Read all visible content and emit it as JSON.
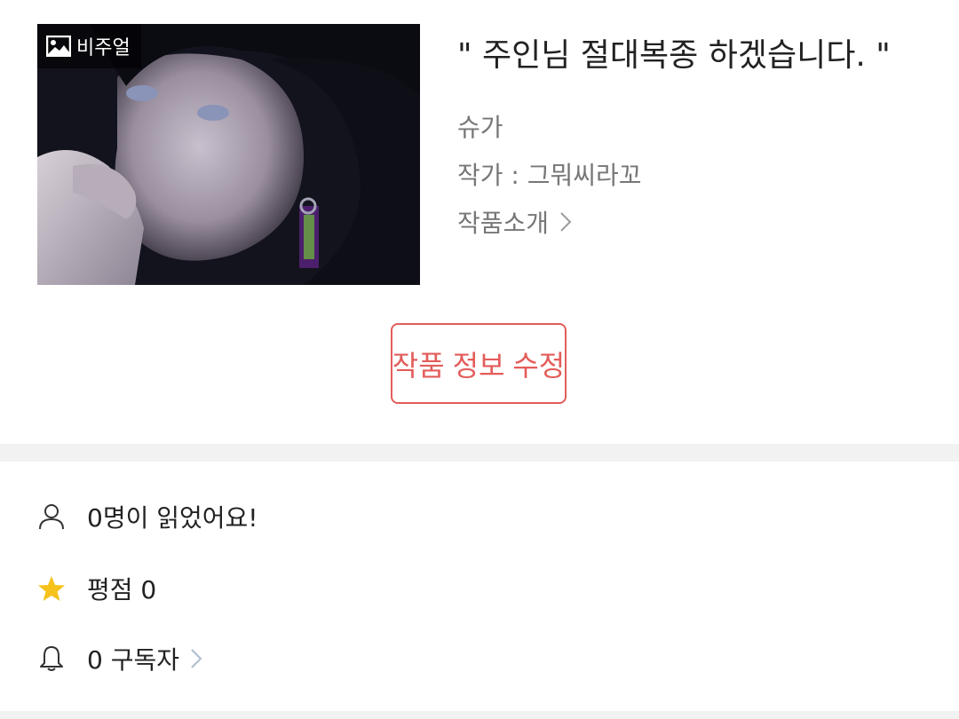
{
  "cover": {
    "badge_label": "비주얼",
    "badge_icon": "image-icon"
  },
  "work": {
    "title": "\" 주인님 절대복종 하겠습니다. \"",
    "genre": "슈가",
    "author": "작가 : 그뭐씨라꼬",
    "intro_link": "작품소개"
  },
  "actions": {
    "edit_label": "작품 정보 수정"
  },
  "stats": {
    "readers": "0명이 읽었어요!",
    "rating": "평점 0",
    "subscribers": "0 구독자"
  },
  "colors": {
    "accent": "#e35d5b",
    "star": "#f6c21c",
    "divider": "#f2f2f2",
    "text_primary": "#222222",
    "text_secondary": "#777777"
  }
}
